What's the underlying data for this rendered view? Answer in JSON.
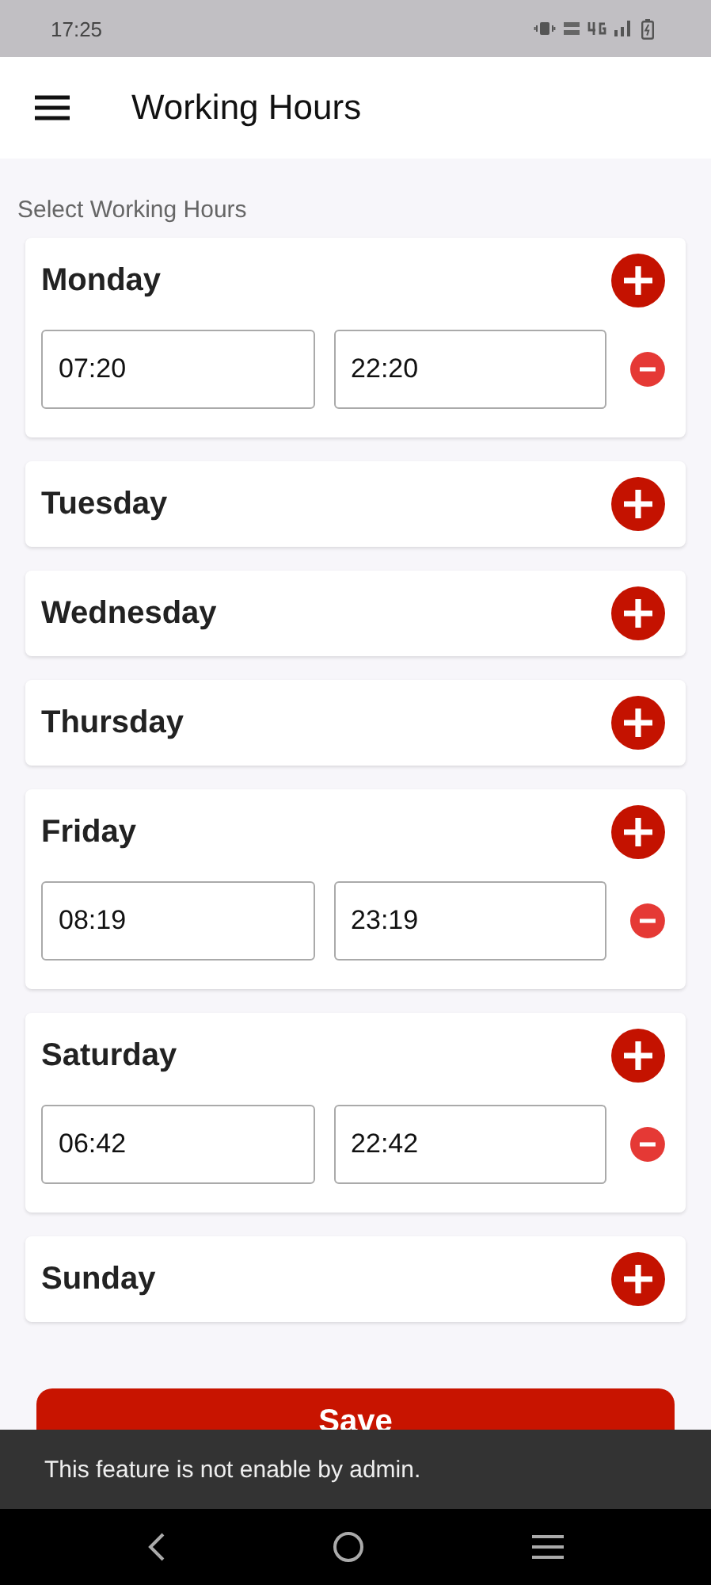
{
  "status_bar": {
    "time": "17:25"
  },
  "app_bar": {
    "title": "Working Hours"
  },
  "section_label": "Select Working Hours",
  "days": [
    {
      "name": "Monday",
      "slots": [
        {
          "start": "07:20",
          "end": "22:20"
        }
      ]
    },
    {
      "name": "Tuesday"
    },
    {
      "name": "Wednesday"
    },
    {
      "name": "Thursday"
    },
    {
      "name": "Friday",
      "slots": [
        {
          "start": "08:19",
          "end": "23:19"
        }
      ]
    },
    {
      "name": "Saturday",
      "slots": [
        {
          "start": "06:42",
          "end": "22:42"
        }
      ]
    },
    {
      "name": "Sunday"
    }
  ],
  "save_button": "Save",
  "snackbar": "This feature is not enable by admin."
}
